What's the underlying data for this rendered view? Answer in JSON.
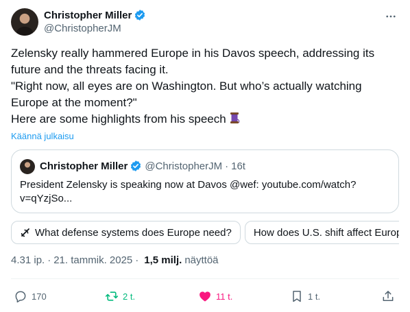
{
  "author": {
    "name": "Christopher Miller",
    "handle": "@ChristopherJM"
  },
  "tweet": {
    "lines": [
      "Zelensky really hammered Europe in his Davos speech, addressing its",
      "future and the threats facing it.",
      "\"Right now, all eyes are on Washington. But who’s actually watching",
      "Europe at the moment?\"",
      "Here are some highlights from his speech"
    ],
    "emoji": "thread-spool-icon",
    "translate_label": "Käännä julkaisu"
  },
  "quote": {
    "name": "Christopher Miller",
    "handle": "@ChristopherJM",
    "separator": "·",
    "time": "16t",
    "text_lines": [
      "President Zelensky is speaking now at Davos @wef: youtube.com/watch?",
      "v=qYzjSo..."
    ]
  },
  "grok_chips": [
    "What defense systems does Europe need?",
    "How does U.S. shift affect Europe"
  ],
  "meta": {
    "time": "4.31 ip.",
    "separator": "·",
    "date": "21. tammik. 2025",
    "views_count": "1,5 milj.",
    "views_label": "näyttöä"
  },
  "actions": {
    "replies": "170",
    "reposts": "2 t.",
    "likes": "11 t.",
    "bookmarks": "1 t."
  },
  "colors": {
    "verified": "#1d9bf0",
    "link": "#1d9bf0",
    "repost_active": "#00ba7c",
    "like_active": "#f91880",
    "secondary_text": "#536471",
    "border": "#cfd9de"
  }
}
